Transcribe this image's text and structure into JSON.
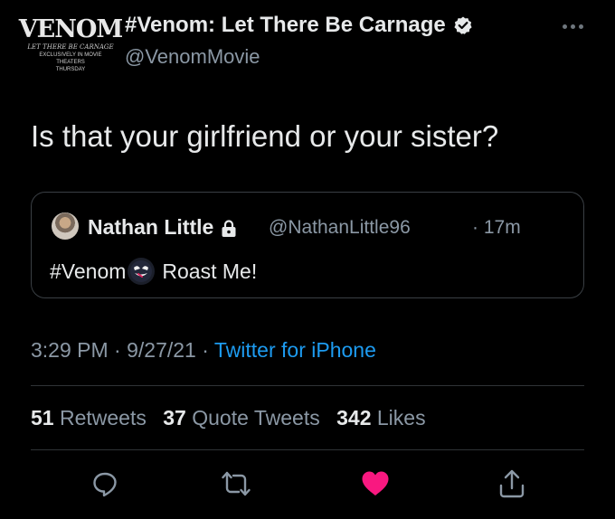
{
  "header": {
    "avatar": {
      "logo_text": "VENOM",
      "logo_subtitle": "LET THERE BE CARNAGE",
      "logo_line1": "EXCLUSIVELY IN MOVIE THEATERS",
      "logo_line2": "THURSDAY"
    },
    "display_name": "#Venom: Let There Be Carnage",
    "handle": "@VenomMovie",
    "more_icon": "ellipsis-icon"
  },
  "tweet": {
    "text": "Is that your girlfriend or your sister?"
  },
  "quote": {
    "name": "Nathan Little",
    "handle": "@NathanLittle96",
    "separator": "·",
    "time": "17m",
    "text_before": "#Venom",
    "emoji": "venom-emoji",
    "text_after": "Roast Me!"
  },
  "meta": {
    "time": "3:29 PM",
    "sep1": " · ",
    "date": "9/27/21",
    "sep2": " · ",
    "source": "Twitter for iPhone"
  },
  "stats": {
    "retweets_count": "51",
    "retweets_label": "Retweets",
    "quotes_count": "37",
    "quotes_label": "Quote Tweets",
    "likes_count": "342",
    "likes_label": "Likes"
  },
  "actions": [
    "reply-icon",
    "retweet-icon",
    "like-icon",
    "share-icon"
  ],
  "colors": {
    "background": "#000000",
    "text": "#e7e9ea",
    "secondary": "#8b98a5",
    "link": "#1d9bf0",
    "like": "#f91880"
  }
}
